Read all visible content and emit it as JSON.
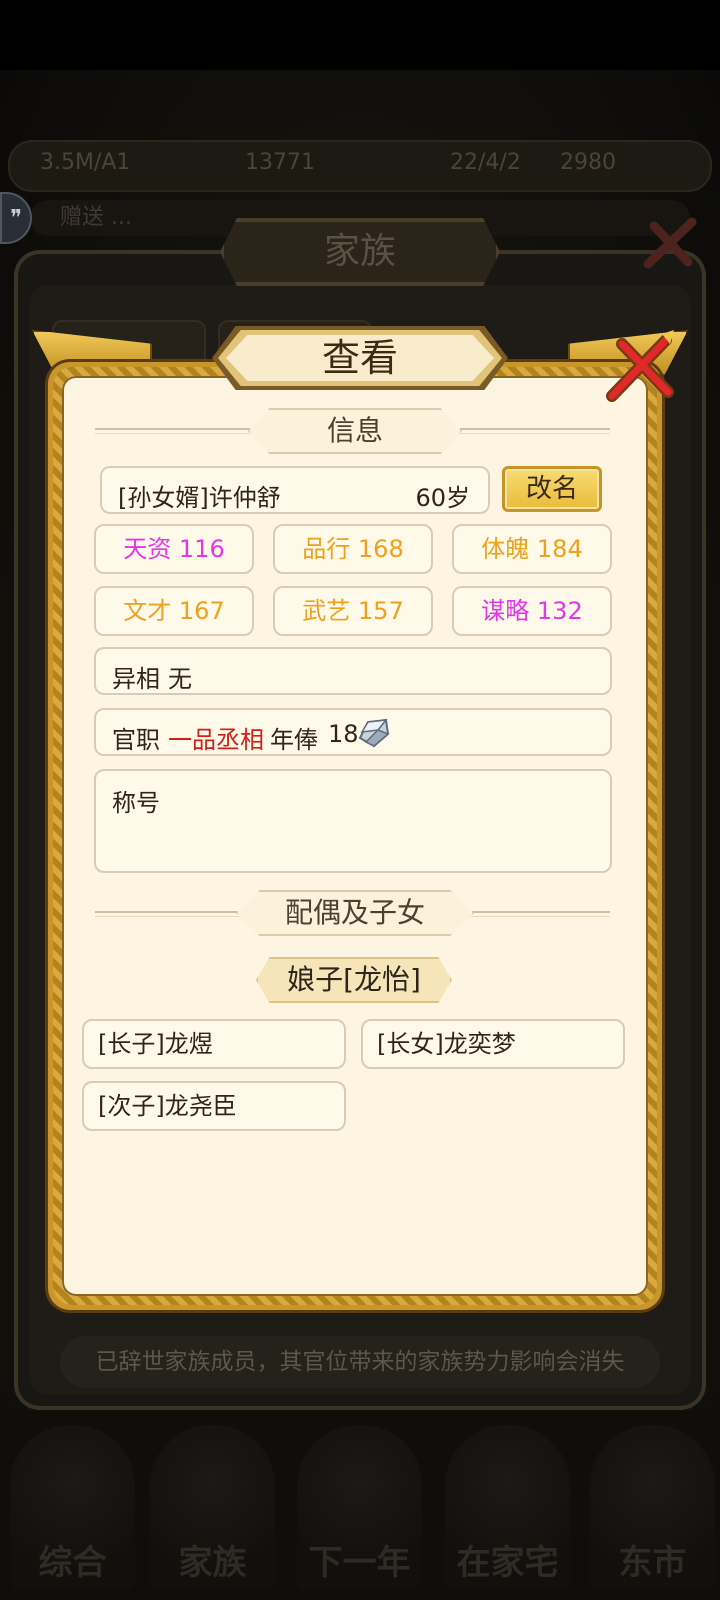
{
  "background": {
    "resource_values": [
      "3.5M/A1",
      "13771",
      "22/4/2",
      "2980"
    ],
    "scroll_message": "赠送 ...",
    "family_title": "家族",
    "family_notice": "已辞世家族成员，其官位带来的家族势力影响会消失",
    "nav_items": [
      "综合",
      "家族",
      "下一年",
      "在家宅",
      "东市"
    ]
  },
  "dialog": {
    "title": "查看",
    "info_section": "信息",
    "member": {
      "name": "[孙女婿]许仲舒",
      "age": "60岁",
      "rename_label": "改名"
    },
    "attributes": [
      {
        "label": "天资 116",
        "color": "#e236e8"
      },
      {
        "label": "品行 168",
        "color": "#eba21c"
      },
      {
        "label": "体魄 184",
        "color": "#eba21c"
      },
      {
        "label": "文才 167",
        "color": "#eba21c"
      },
      {
        "label": "武艺 157",
        "color": "#eba21c"
      },
      {
        "label": "谋略 132",
        "color": "#e236e8"
      }
    ],
    "trait": {
      "label": "异相",
      "value": "无"
    },
    "office": {
      "label": "官职",
      "rank": "一品丞相",
      "salary_label": "年俸",
      "salary_value": "18",
      "salary_icon": "silver-ingot-icon"
    },
    "title_field": {
      "label": "称号"
    },
    "family_section": "配偶及子女",
    "spouse": "娘子[龙怡]",
    "children": [
      "[长子]龙煜",
      "[长女]龙奕梦",
      "[次子]龙尧臣"
    ]
  }
}
